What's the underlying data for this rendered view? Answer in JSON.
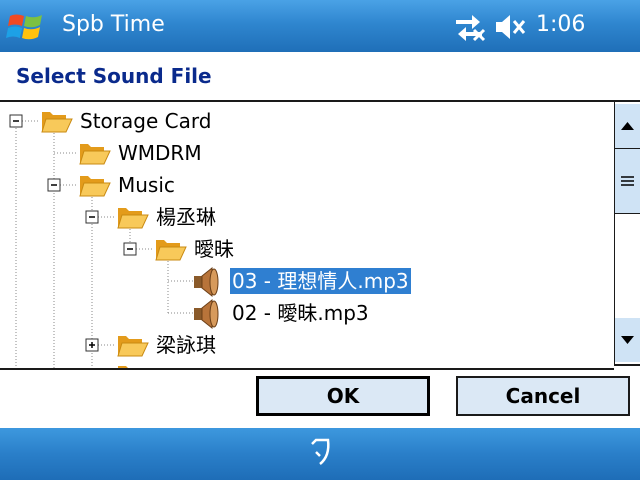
{
  "titlebar": {
    "title": "Spb Time",
    "clock": "1:06",
    "icons": [
      "windows-start-logo",
      "connectivity-icon",
      "volume-muted-icon"
    ]
  },
  "dialog": {
    "heading": "Select Sound File"
  },
  "tree": {
    "nodes": [
      {
        "label": "Storage Card",
        "type": "folder",
        "expander": "minus",
        "level": 0
      },
      {
        "label": "WMDRM",
        "type": "folder",
        "expander": "none",
        "level": 1
      },
      {
        "label": "Music",
        "type": "folder",
        "expander": "minus",
        "level": 1
      },
      {
        "label": "楊丞琳",
        "type": "folder",
        "expander": "minus",
        "level": 2
      },
      {
        "label": "曖昧",
        "type": "folder",
        "expander": "minus",
        "level": 3
      },
      {
        "label": "03 - 理想情人.mp3",
        "type": "sound",
        "expander": "none",
        "level": 4,
        "selected": true
      },
      {
        "label": "02 - 曖昧.mp3",
        "type": "sound",
        "expander": "none",
        "level": 4
      },
      {
        "label": "梁詠琪",
        "type": "folder",
        "expander": "plus",
        "level": 2
      }
    ]
  },
  "buttons": {
    "ok": "OK",
    "cancel": "Cancel"
  },
  "colors": {
    "titlebar": "#2f86cf",
    "heading": "#0a2a8c",
    "selection": "#2f7fd1",
    "button_fill": "#dbe8f5",
    "folder": "#f5b431"
  }
}
